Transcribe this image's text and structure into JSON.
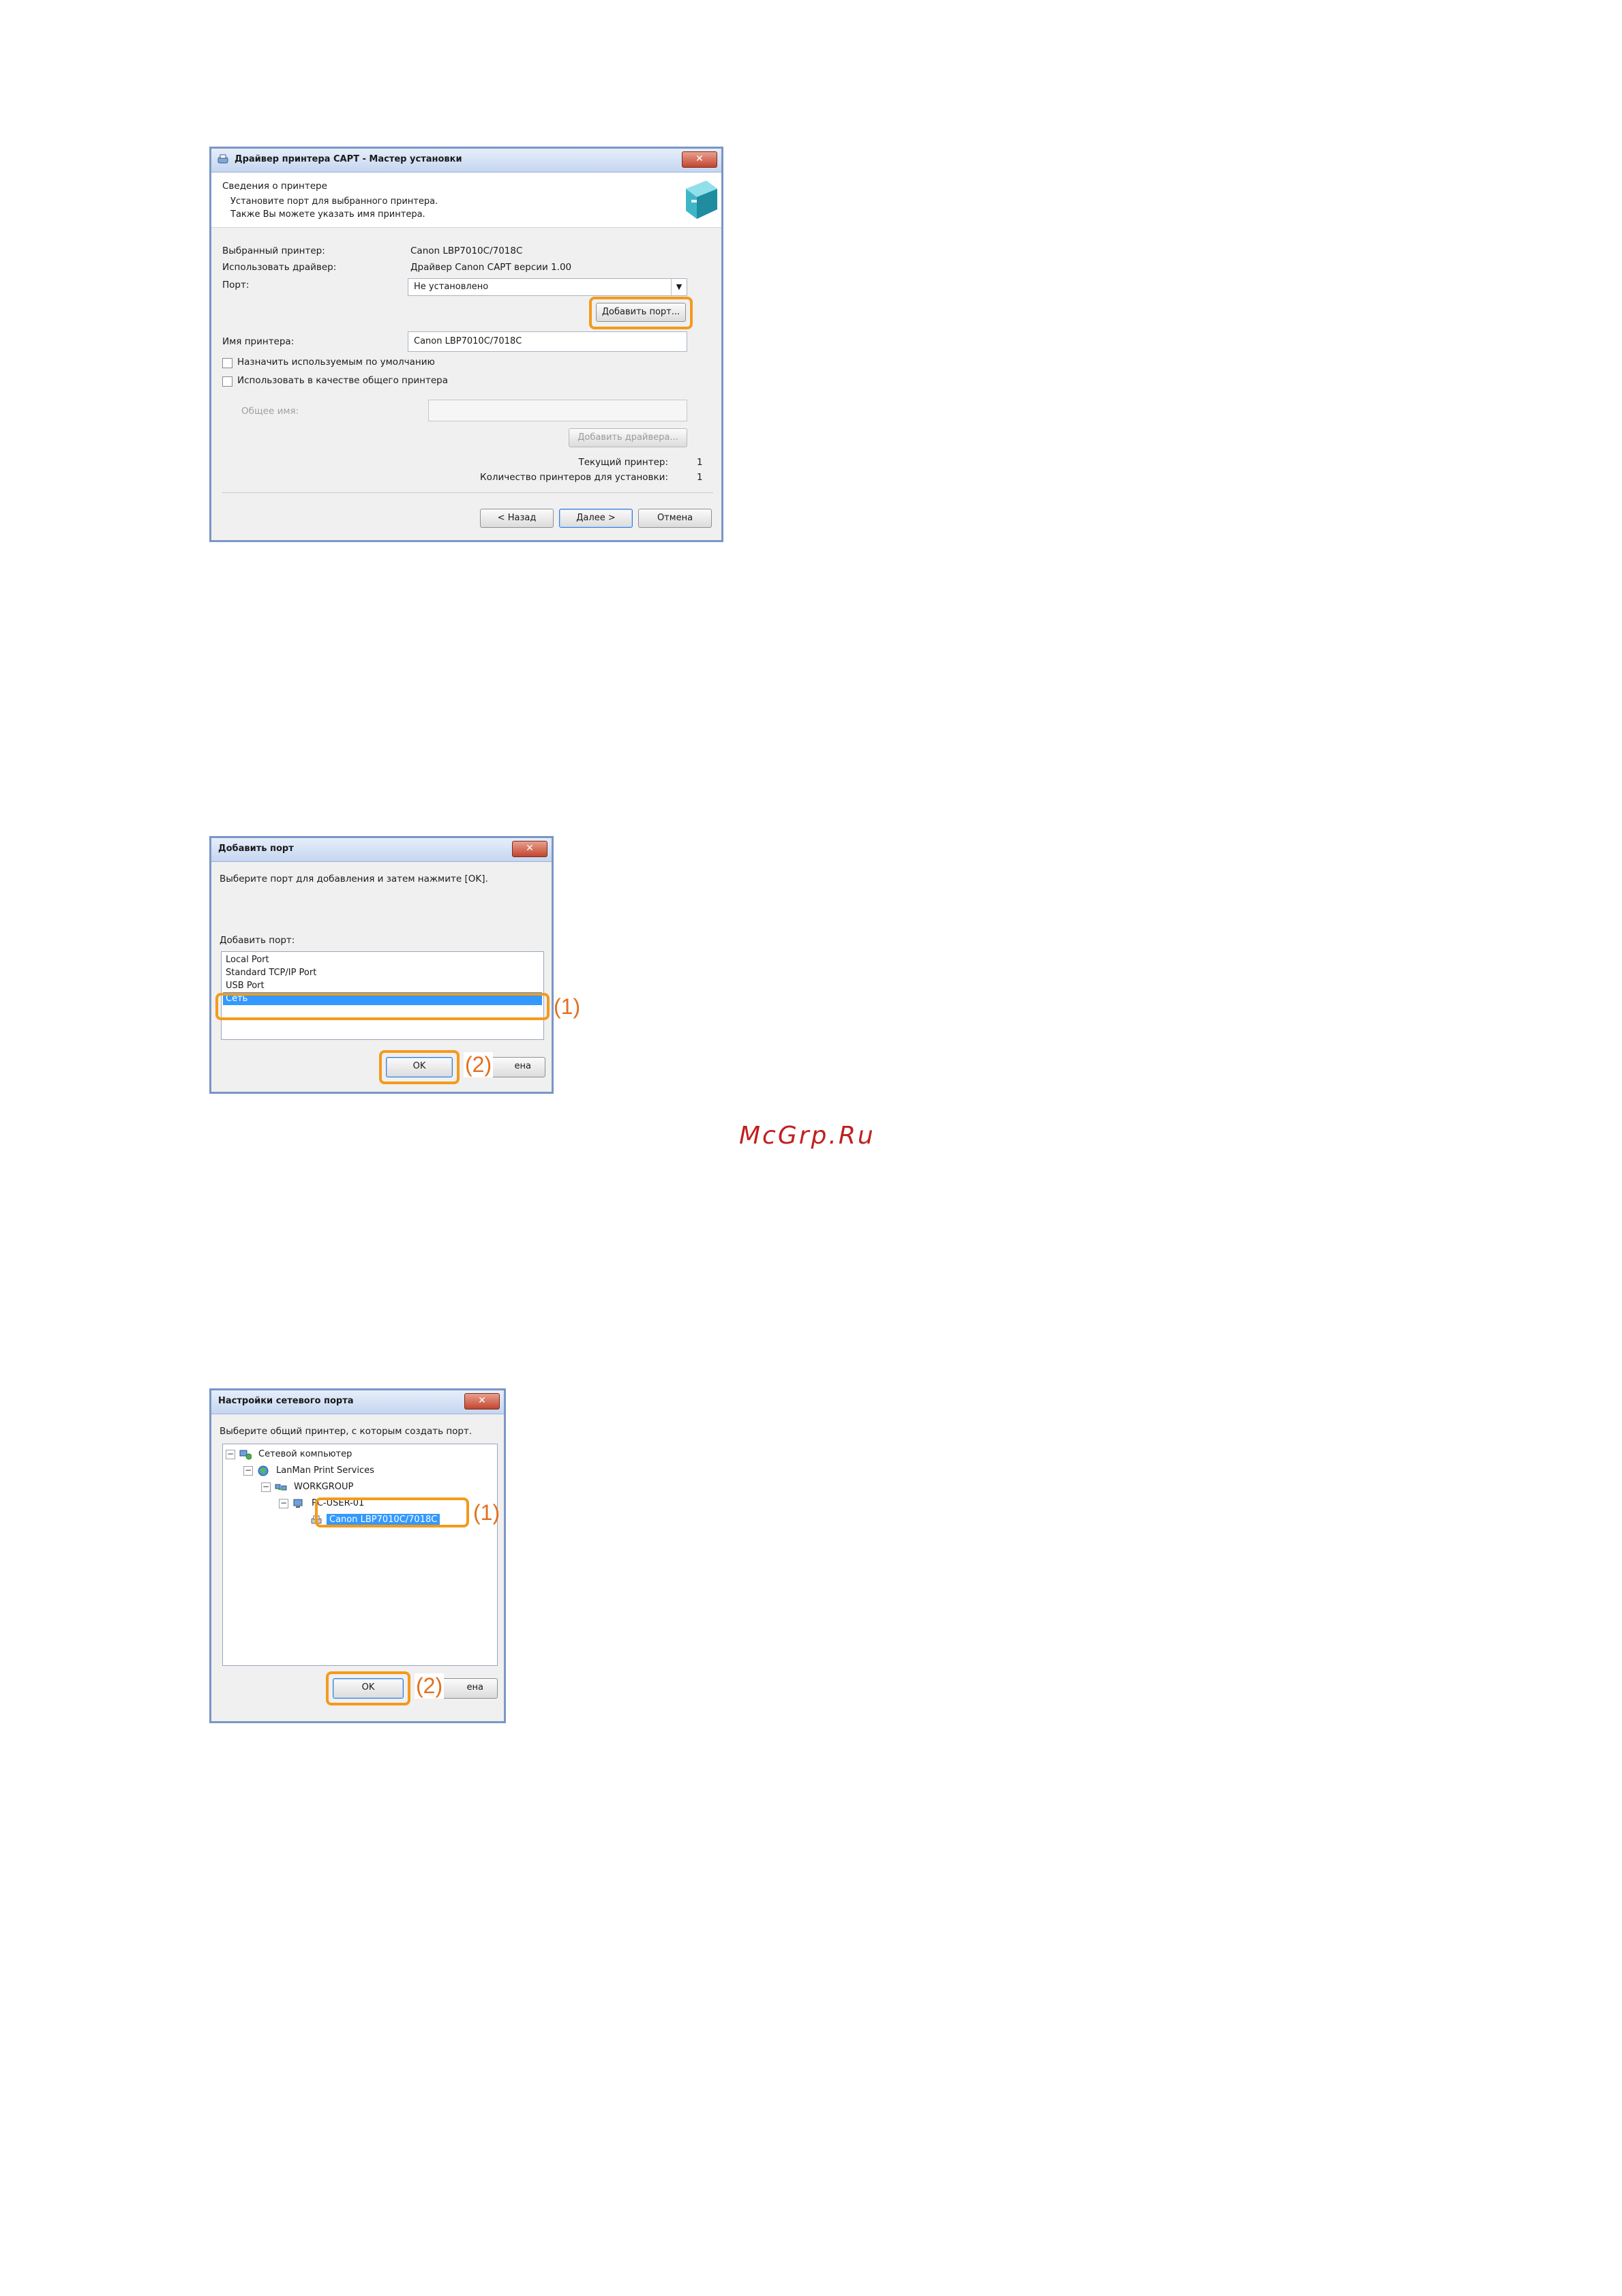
{
  "watermark": "McGrp.Ru",
  "wizard": {
    "title": "Драйвер принтера CAPT - Мастер установки",
    "close": "✕",
    "section_title": "Сведения о принтере",
    "section_sub1": "Установите порт для выбранного принтера.",
    "section_sub2": "Также Вы можете указать имя принтера.",
    "selected_printer_label": "Выбранный принтер:",
    "selected_printer_value": "Canon LBP7010C/7018C",
    "driver_label": "Использовать драйвер:",
    "driver_value": "Драйвер Canon CAPT версии 1.00",
    "port_label": "Порт:",
    "port_value": "Не установлено",
    "add_port_button": "Добавить порт...",
    "printer_name_label": "Имя принтера:",
    "printer_name_value": "Canon LBP7010C/7018C",
    "default_checkbox": "Назначить используемым по умолчанию",
    "shared_checkbox": "Использовать в качестве общего принтера",
    "share_name_label": "Общее имя:",
    "share_name_value": "",
    "add_drivers_button": "Добавить драйвера...",
    "current_printer_label": "Текущий принтер:",
    "current_printer_value": "1",
    "count_label": "Количество принтеров для установки:",
    "count_value": "1",
    "back_button": "< Назад",
    "next_button": "Далее >",
    "cancel_button": "Отмена"
  },
  "addport": {
    "title": "Добавить порт",
    "close": "✕",
    "instruction": "Выберите порт для добавления и затем нажмите [OK].",
    "list_label": "Добавить порт:",
    "items": [
      "Local Port",
      "Standard TCP/IP Port",
      "USB Port",
      "Сеть"
    ],
    "selected_index": 3,
    "ok_button": "OK",
    "cancel_partial": "ена",
    "callout1": "(1)",
    "callout2": "(2)"
  },
  "netport": {
    "title": "Настройки сетевого порта",
    "close": "✕",
    "instruction": "Выберите общий принтер, с которым создать порт.",
    "tree": [
      {
        "label": "Сетевой компьютер",
        "level": 0,
        "expander": "−",
        "icon": "network-computer-icon"
      },
      {
        "label": "LanMan Print Services",
        "level": 1,
        "expander": "−",
        "icon": "globe-icon"
      },
      {
        "label": "WORKGROUP",
        "level": 2,
        "expander": "−",
        "icon": "workgroup-icon"
      },
      {
        "label": "PC-USER-01",
        "level": 3,
        "expander": "−",
        "icon": "computer-icon"
      },
      {
        "label": "Canon LBP7010C/7018C",
        "level": 4,
        "expander": "",
        "icon": "printer-icon",
        "selected": true
      }
    ],
    "ok_button": "OK",
    "cancel_partial": "ена",
    "callout1": "(1)",
    "callout2": "(2)"
  }
}
